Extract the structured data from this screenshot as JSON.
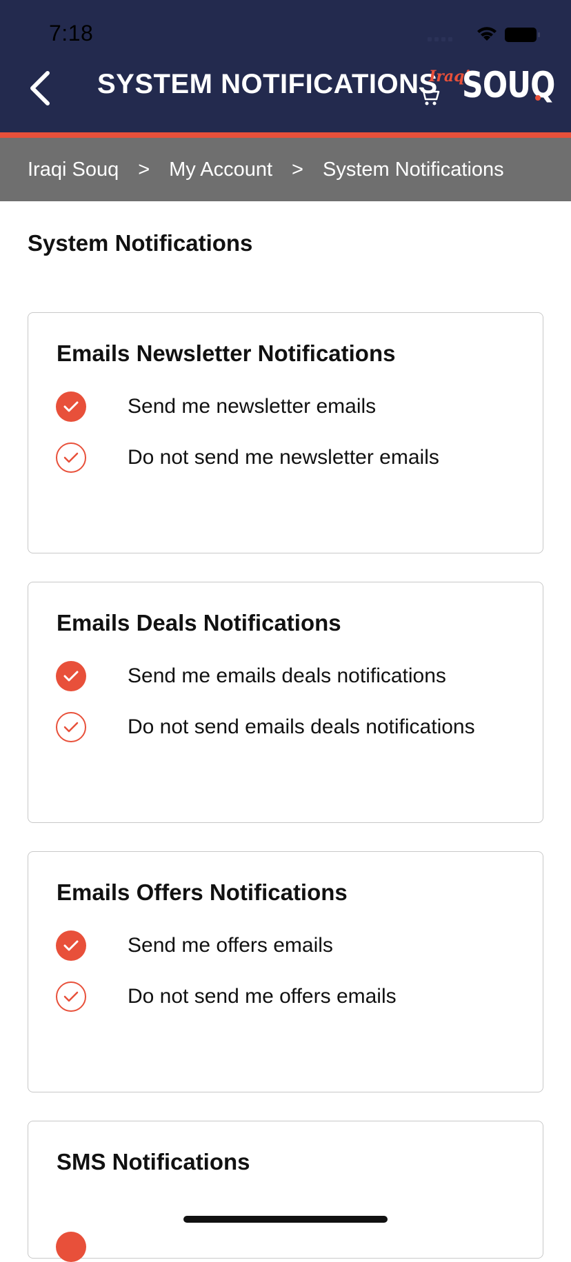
{
  "status_bar": {
    "time": "7:18"
  },
  "header": {
    "title": "SYSTEM NOTIFICATIONS",
    "logo_script": "Iraqi",
    "logo_word": "SOUQ"
  },
  "breadcrumb": {
    "items": [
      "Iraqi Souq",
      "My Account",
      "System Notifications"
    ],
    "separator": ">"
  },
  "page": {
    "title": "System Notifications"
  },
  "cards": [
    {
      "title": "Emails Newsletter Notifications",
      "options": [
        {
          "label": "Send me newsletter emails",
          "checked": true
        },
        {
          "label": "Do not send me newsletter emails",
          "checked": false
        }
      ]
    },
    {
      "title": "Emails Deals Notifications",
      "options": [
        {
          "label": "Send me emails deals notifications",
          "checked": true
        },
        {
          "label": "Do not send emails deals notifications",
          "checked": false
        }
      ]
    },
    {
      "title": "Emails Offers Notifications",
      "options": [
        {
          "label": "Send me offers emails",
          "checked": true
        },
        {
          "label": "Do not send me offers emails",
          "checked": false
        }
      ]
    },
    {
      "title": "SMS Notifications",
      "options": []
    }
  ],
  "colors": {
    "header_bg": "#232a4e",
    "accent": "#e8503a",
    "breadcrumb_bg": "#6f6f6f"
  }
}
